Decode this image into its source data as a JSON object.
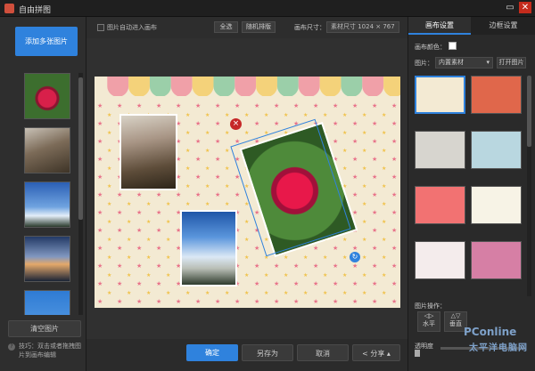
{
  "window": {
    "title": "自由拼图",
    "min_label": "▭",
    "close_label": "✕"
  },
  "left": {
    "add_button": "添加多张图片",
    "clear_button": "清空图片",
    "tip_icon": "?",
    "tip_text": "技巧：双击或者拖拽图片到画布编辑"
  },
  "toolbar": {
    "auto_checkbox_label": "图片自动进入画布",
    "select_all": "全选",
    "random_arrange": "随机排版",
    "size_label": "画布尺寸：",
    "size_value": "素材尺寸 1024 × 767"
  },
  "handles": {
    "delete": "×",
    "rotate": "↻"
  },
  "bottom": {
    "ok": "确定",
    "save_as": "另存为",
    "cancel": "取消",
    "share": "分享"
  },
  "right": {
    "tabs": [
      "画布设置",
      "边框设置"
    ],
    "color_label": "画布颜色：",
    "image_label": "图片：",
    "material_value": "内置素材",
    "open_button": "打开图片",
    "ops_label": "图片操作：",
    "op_horizontal": "水平",
    "op_vertical": "垂直",
    "opacity_label": "透明度"
  },
  "watermark": {
    "line1": "PConline",
    "line2": "太平洋电脑网"
  },
  "colors": {
    "accent": "#2f82dd",
    "canvas_bg": "#f3ead3",
    "close": "#c42b1c"
  }
}
